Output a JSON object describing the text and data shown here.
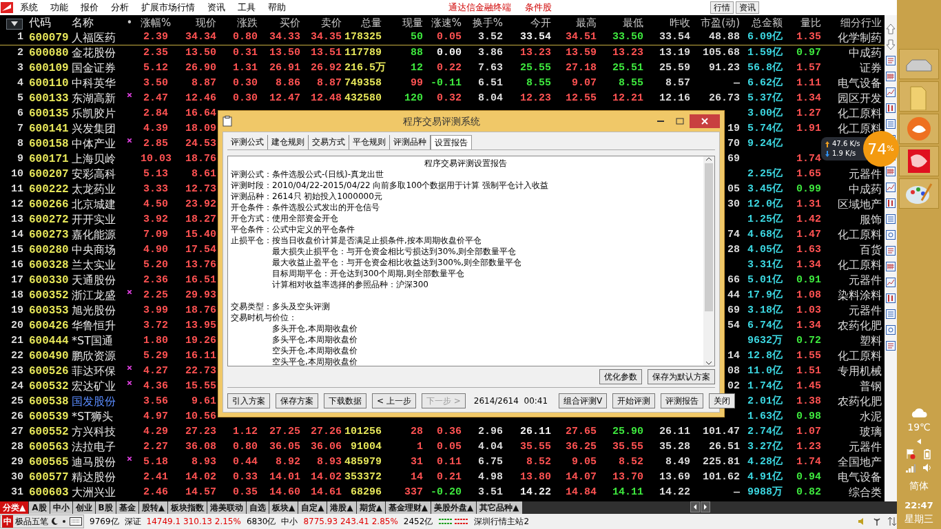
{
  "menu_bar": {
    "items": [
      "系统",
      "功能",
      "报价",
      "分析",
      "扩展市场行情",
      "资讯",
      "工具",
      "帮助"
    ],
    "titles": [
      "通达信金融终端",
      "条件股"
    ],
    "buttons": [
      "行情",
      "资讯"
    ]
  },
  "table": {
    "code_label": "代码",
    "name_label": "名称",
    "flag_label": "•",
    "columns": [
      {
        "label": "涨幅%",
        "kind": "price"
      },
      {
        "label": "现价",
        "kind": "price"
      },
      {
        "label": "涨跌",
        "kind": "price"
      },
      {
        "label": "买价",
        "kind": "price"
      },
      {
        "label": "卖价",
        "kind": "price"
      },
      {
        "label": "总量",
        "kind": "volume"
      },
      {
        "label": "现量",
        "kind": "price"
      },
      {
        "label": "涨速%",
        "kind": "price"
      },
      {
        "label": "换手%",
        "kind": "plain"
      },
      {
        "label": "今开",
        "kind": "price"
      },
      {
        "label": "最高",
        "kind": "price"
      },
      {
        "label": "最低",
        "kind": "price"
      },
      {
        "label": "昨收",
        "kind": "plain"
      },
      {
        "label": "市盈(动)",
        "kind": "plain"
      },
      {
        "label": "总金额",
        "kind": "amount"
      },
      {
        "label": "量比",
        "kind": "price"
      },
      {
        "label": "细分行业",
        "kind": "industry"
      }
    ],
    "rows": [
      {
        "no": "1",
        "code": "600079",
        "name": "人福医药",
        "flagged": false,
        "selected": true,
        "highlighted": false,
        "cells": [
          "2.39",
          "34.34",
          "0.80",
          "34.33",
          "34.35",
          "178325",
          {
            "text": "50",
            "color": "#3ee83e"
          },
          "0.05",
          "3.52",
          {
            "text": "33.54",
            "color": "#f2f2f2"
          },
          "34.51",
          {
            "text": "33.50",
            "color": "#3ee83e"
          },
          "33.54",
          "48.88",
          "6.09亿",
          "1.35",
          "化学制药"
        ]
      },
      {
        "no": "2",
        "code": "600080",
        "name": "金花股份",
        "flagged": false,
        "selected": false,
        "highlighted": false,
        "cells": [
          "2.35",
          "13.50",
          "0.31",
          "13.50",
          "13.51",
          "117789",
          {
            "text": "88",
            "color": "#3ee83e"
          },
          {
            "text": "0.00",
            "color": "#f2f2f2"
          },
          "3.86",
          "13.23",
          "13.59",
          "13.23",
          "13.19",
          "105.68",
          "1.59亿",
          {
            "text": "0.97",
            "color": "#3ee83e"
          },
          "中成药"
        ]
      },
      {
        "no": "3",
        "code": "600109",
        "name": "国金证券",
        "flagged": false,
        "selected": false,
        "highlighted": false,
        "cells": [
          "5.12",
          "26.90",
          "1.31",
          "26.91",
          "26.92",
          "216.5万",
          {
            "text": "12",
            "color": "#3ee83e"
          },
          "0.22",
          "7.63",
          {
            "text": "25.55",
            "color": "#3ee83e"
          },
          "27.18",
          {
            "text": "25.51",
            "color": "#3ee83e"
          },
          "25.59",
          "91.23",
          "56.8亿",
          "1.57",
          "证券"
        ]
      },
      {
        "no": "4",
        "code": "600110",
        "name": "中科英华",
        "flagged": false,
        "selected": false,
        "highlighted": false,
        "cells": [
          "3.50",
          "8.87",
          "0.30",
          "8.86",
          "8.87",
          "749358",
          "99",
          {
            "text": "-0.11",
            "color": "#3ee83e"
          },
          "6.51",
          {
            "text": "8.55",
            "color": "#3ee83e"
          },
          "9.07",
          {
            "text": "8.55",
            "color": "#3ee83e"
          },
          "8.57",
          "—",
          "6.62亿",
          "1.11",
          "电气设备"
        ]
      },
      {
        "no": "5",
        "code": "600133",
        "name": "东湖高新",
        "flagged": true,
        "selected": false,
        "highlighted": false,
        "cells": [
          "2.47",
          "12.46",
          "0.30",
          "12.47",
          "12.48",
          "432580",
          {
            "text": "120",
            "color": "#3ee83e"
          },
          "0.32",
          "8.04",
          "12.23",
          "12.55",
          "12.21",
          "12.16",
          "26.73",
          "5.37亿",
          "1.34",
          "园区开发"
        ]
      },
      {
        "no": "6",
        "code": "600135",
        "name": "乐凯胶片",
        "flagged": false,
        "selected": false,
        "highlighted": false,
        "cells": [
          "2.84",
          "16.64",
          null,
          null,
          null,
          null,
          null,
          null,
          null,
          null,
          null,
          null,
          null,
          null,
          "3.00亿",
          "1.27",
          "化工原料"
        ]
      },
      {
        "no": "7",
        "code": "600141",
        "name": "兴发集团",
        "flagged": false,
        "selected": false,
        "highlighted": false,
        "cells": [
          "4.39",
          "18.09",
          null,
          null,
          null,
          null,
          null,
          null,
          null,
          null,
          null,
          null,
          null,
          "19",
          "5.74亿",
          "1.91",
          "化工原料"
        ]
      },
      {
        "no": "8",
        "code": "600158",
        "name": "中体产业",
        "flagged": true,
        "selected": false,
        "highlighted": false,
        "cells": [
          "2.85",
          "24.53",
          null,
          null,
          null,
          null,
          null,
          null,
          null,
          null,
          null,
          null,
          null,
          "70",
          "9.24亿",
          null,
          null
        ]
      },
      {
        "no": "9",
        "code": "600171",
        "name": "上海贝岭",
        "flagged": false,
        "selected": false,
        "highlighted": false,
        "cells": [
          "10.03",
          "18.76",
          null,
          null,
          null,
          null,
          null,
          null,
          null,
          null,
          null,
          null,
          null,
          "69",
          null,
          "1.74",
          null
        ]
      },
      {
        "no": "10",
        "code": "600207",
        "name": "安彩高科",
        "flagged": false,
        "selected": false,
        "highlighted": false,
        "cells": [
          "5.13",
          "8.61",
          null,
          null,
          null,
          null,
          null,
          null,
          null,
          null,
          null,
          null,
          null,
          null,
          "2.25亿",
          "1.65",
          "元器件"
        ]
      },
      {
        "no": "11",
        "code": "600222",
        "name": "太龙药业",
        "flagged": false,
        "selected": false,
        "highlighted": false,
        "cells": [
          "3.33",
          "12.73",
          null,
          null,
          null,
          null,
          null,
          null,
          null,
          null,
          null,
          null,
          null,
          "05",
          "3.45亿",
          {
            "text": "0.99",
            "color": "#3ee83e"
          },
          "中成药"
        ]
      },
      {
        "no": "12",
        "code": "600266",
        "name": "北京城建",
        "flagged": false,
        "selected": false,
        "highlighted": false,
        "cells": [
          "4.50",
          "23.92",
          null,
          null,
          null,
          null,
          null,
          null,
          null,
          null,
          null,
          null,
          null,
          "30",
          "12.0亿",
          "1.31",
          "区域地产"
        ]
      },
      {
        "no": "13",
        "code": "600272",
        "name": "开开实业",
        "flagged": false,
        "selected": false,
        "highlighted": false,
        "cells": [
          "3.92",
          "18.27",
          null,
          null,
          null,
          null,
          null,
          null,
          null,
          null,
          null,
          null,
          null,
          null,
          "1.25亿",
          "1.42",
          "服饰"
        ]
      },
      {
        "no": "14",
        "code": "600273",
        "name": "嘉化能源",
        "flagged": false,
        "selected": false,
        "highlighted": false,
        "cells": [
          "7.09",
          "15.40",
          null,
          null,
          null,
          null,
          null,
          null,
          null,
          null,
          null,
          null,
          null,
          "74",
          "4.68亿",
          "1.47",
          "化工原料"
        ]
      },
      {
        "no": "15",
        "code": "600280",
        "name": "中央商场",
        "flagged": false,
        "selected": false,
        "highlighted": false,
        "cells": [
          "4.90",
          "17.54",
          null,
          null,
          null,
          null,
          null,
          null,
          null,
          null,
          null,
          null,
          null,
          "28",
          "4.05亿",
          "1.63",
          "百货"
        ]
      },
      {
        "no": "16",
        "code": "600328",
        "name": "兰太实业",
        "flagged": false,
        "selected": false,
        "highlighted": false,
        "cells": [
          "5.20",
          "13.76",
          null,
          null,
          null,
          null,
          null,
          null,
          null,
          null,
          null,
          null,
          null,
          null,
          "3.31亿",
          "1.34",
          "化工原料"
        ]
      },
      {
        "no": "17",
        "code": "600330",
        "name": "天通股份",
        "flagged": false,
        "selected": false,
        "highlighted": false,
        "cells": [
          "2.36",
          "16.51",
          null,
          null,
          null,
          null,
          null,
          null,
          null,
          null,
          null,
          null,
          null,
          "66",
          "5.01亿",
          {
            "text": "0.91",
            "color": "#3ee83e"
          },
          "元器件"
        ]
      },
      {
        "no": "18",
        "code": "600352",
        "name": "浙江龙盛",
        "flagged": true,
        "selected": false,
        "highlighted": false,
        "cells": [
          "2.25",
          "29.93",
          null,
          null,
          null,
          null,
          null,
          null,
          null,
          null,
          null,
          null,
          null,
          "44",
          "17.9亿",
          "1.08",
          "染料涂料"
        ]
      },
      {
        "no": "19",
        "code": "600353",
        "name": "旭光股份",
        "flagged": false,
        "selected": false,
        "highlighted": false,
        "cells": [
          "3.99",
          "18.76",
          null,
          null,
          null,
          null,
          null,
          null,
          null,
          null,
          null,
          null,
          null,
          "69",
          "3.18亿",
          "1.03",
          "元器件"
        ]
      },
      {
        "no": "20",
        "code": "600426",
        "name": "华鲁恒升",
        "flagged": false,
        "selected": false,
        "highlighted": false,
        "cells": [
          "3.72",
          "13.95",
          null,
          null,
          null,
          null,
          null,
          null,
          null,
          null,
          null,
          null,
          null,
          "54",
          "6.74亿",
          "1.34",
          "农药化肥"
        ]
      },
      {
        "no": "21",
        "code": "600444",
        "name": "*ST国通",
        "flagged": false,
        "selected": false,
        "highlighted": false,
        "cells": [
          "1.80",
          "19.26",
          null,
          null,
          null,
          null,
          null,
          null,
          null,
          null,
          null,
          null,
          null,
          null,
          "9632万",
          {
            "text": "0.72",
            "color": "#3ee83e"
          },
          "塑料"
        ]
      },
      {
        "no": "22",
        "code": "600490",
        "name": "鹏欣资源",
        "flagged": false,
        "selected": false,
        "highlighted": false,
        "cells": [
          "5.29",
          "16.11",
          null,
          null,
          null,
          null,
          null,
          null,
          null,
          null,
          null,
          null,
          null,
          "14",
          "12.8亿",
          "1.55",
          "化工原料"
        ]
      },
      {
        "no": "23",
        "code": "600526",
        "name": "菲达环保",
        "flagged": true,
        "selected": false,
        "highlighted": false,
        "cells": [
          "4.27",
          "22.73",
          null,
          null,
          null,
          null,
          null,
          null,
          null,
          null,
          null,
          null,
          null,
          "08",
          "11.0亿",
          "1.51",
          "专用机械"
        ]
      },
      {
        "no": "24",
        "code": "600532",
        "name": "宏达矿业",
        "flagged": true,
        "selected": false,
        "highlighted": false,
        "cells": [
          "4.36",
          "15.55",
          null,
          null,
          null,
          null,
          null,
          null,
          null,
          null,
          null,
          null,
          null,
          "02",
          "1.74亿",
          "1.45",
          "普钢"
        ]
      },
      {
        "no": "25",
        "code": "600538",
        "name": "国发股份",
        "flagged": false,
        "selected": false,
        "highlighted": true,
        "cells": [
          "3.56",
          "9.61",
          null,
          null,
          null,
          null,
          null,
          null,
          null,
          null,
          null,
          null,
          null,
          null,
          "2.01亿",
          "1.38",
          "农药化肥"
        ]
      },
      {
        "no": "26",
        "code": "600539",
        "name": "*ST狮头",
        "flagged": false,
        "selected": false,
        "highlighted": false,
        "cells": [
          "4.97",
          "10.56",
          null,
          null,
          null,
          null,
          null,
          null,
          null,
          null,
          null,
          null,
          null,
          null,
          "1.63亿",
          {
            "text": "0.98",
            "color": "#3ee83e"
          },
          "水泥"
        ]
      },
      {
        "no": "27",
        "code": "600552",
        "name": "方兴科技",
        "flagged": false,
        "selected": false,
        "highlighted": false,
        "cells": [
          "4.29",
          "27.23",
          "1.12",
          "27.25",
          "27.26",
          "101256",
          "28",
          "0.36",
          "2.96",
          {
            "text": "26.11",
            "color": "#f2f2f2"
          },
          "27.65",
          {
            "text": "25.90",
            "color": "#3ee83e"
          },
          "26.11",
          "101.47",
          "2.74亿",
          "1.07",
          "玻璃"
        ]
      },
      {
        "no": "28",
        "code": "600563",
        "name": "法拉电子",
        "flagged": false,
        "selected": false,
        "highlighted": false,
        "cells": [
          "2.27",
          "36.08",
          "0.80",
          "36.05",
          "36.06",
          "91004",
          "1",
          "0.05",
          "4.04",
          "35.55",
          "36.25",
          "35.55",
          "35.28",
          "26.51",
          "3.27亿",
          "1.23",
          "元器件"
        ]
      },
      {
        "no": "29",
        "code": "600565",
        "name": "迪马股份",
        "flagged": true,
        "selected": false,
        "highlighted": false,
        "cells": [
          "5.18",
          "8.93",
          "0.44",
          "8.92",
          "8.93",
          "485979",
          "31",
          "0.11",
          "6.75",
          "8.52",
          "9.05",
          "8.52",
          "8.49",
          "225.81",
          "4.28亿",
          "1.74",
          "全国地产"
        ]
      },
      {
        "no": "30",
        "code": "600577",
        "name": "精达股份",
        "flagged": false,
        "selected": false,
        "highlighted": false,
        "cells": [
          "2.41",
          "14.02",
          "0.33",
          "14.01",
          "14.02",
          "353372",
          "14",
          "0.21",
          "4.98",
          "13.80",
          "14.07",
          "13.70",
          "13.69",
          "101.62",
          "4.91亿",
          {
            "text": "0.94",
            "color": "#3ee83e"
          },
          "电气设备"
        ]
      },
      {
        "no": "31",
        "code": "600603",
        "name": "大洲兴业",
        "flagged": false,
        "selected": false,
        "highlighted": false,
        "cells": [
          "2.46",
          "14.57",
          "0.35",
          "14.60",
          "14.61",
          "68296",
          "337",
          {
            "text": "-0.20",
            "color": "#3ee83e"
          },
          "3.51",
          {
            "text": "14.22",
            "color": "#f2f2f2"
          },
          "14.84",
          {
            "text": "14.11",
            "color": "#3ee83e"
          },
          "14.22",
          "—",
          "9988万",
          {
            "text": "0.82",
            "color": "#3ee83e"
          },
          "综合类"
        ]
      }
    ]
  },
  "market_tabs": [
    {
      "label": "分类▲",
      "selected": true
    },
    {
      "label": "A股",
      "selected": false
    },
    {
      "label": "中小",
      "selected": false
    },
    {
      "label": "创业",
      "selected": false
    },
    {
      "label": "B股",
      "selected": false
    },
    {
      "label": "基金",
      "selected": false
    },
    {
      "label": "股转▲",
      "selected": false
    },
    {
      "label": "板块指数",
      "selected": false
    },
    {
      "label": "港美联动",
      "selected": false
    },
    {
      "label": "自选",
      "selected": false
    },
    {
      "label": "板块▲",
      "selected": false
    },
    {
      "label": "自定▲",
      "selected": false
    },
    {
      "label": "港股▲",
      "selected": false
    },
    {
      "label": "期货▲",
      "selected": false
    },
    {
      "label": "基金理财▲",
      "selected": false
    },
    {
      "label": "美股外盘▲",
      "selected": false
    },
    {
      "label": "其它品种▲",
      "selected": false
    }
  ],
  "status_bar": {
    "ime": {
      "mode": "中",
      "name": "极品五笔"
    },
    "tickers": [
      {
        "amount": "9769亿"
      },
      {
        "label": "深证",
        "quote": "14749.1  310.13  2.15%",
        "rising": true,
        "amount": "6830亿"
      },
      {
        "label": "中小",
        "quote": "8775.93  243.41  2.85%",
        "rising": true,
        "amount": "2452亿"
      }
    ],
    "server": "深圳行情主站2"
  },
  "dialog": {
    "title": "程序交易评测系统",
    "tabs": [
      {
        "label": "评测公式",
        "selected": false
      },
      {
        "label": "建仓规则",
        "selected": false
      },
      {
        "label": "交易方式",
        "selected": false
      },
      {
        "label": "平仓规则",
        "selected": false
      },
      {
        "label": "评测品种",
        "selected": false
      },
      {
        "label": "设置报告",
        "selected": true
      }
    ],
    "report": [
      {
        "kind": "title",
        "text": "程序交易评测设置报告"
      },
      {
        "kind": "line",
        "text": "评测公式：条件选股公式-(日线)-真龙出世"
      },
      {
        "kind": "line",
        "text": "评测时段：2010/04/22-2015/04/22 向前多取100个数据用于计算 强制平仓计入收益"
      },
      {
        "kind": "line",
        "text": "评测品种：2614只  初始投入1000000元"
      },
      {
        "kind": "line",
        "text": "开仓条件：条件选股公式发出的开仓信号"
      },
      {
        "kind": "line",
        "text": "开仓方式：使用全部资金开仓"
      },
      {
        "kind": "line",
        "text": "平仓条件：公式中定义的平仓条件"
      },
      {
        "kind": "line",
        "text": "止损平仓：按当日收盘价计算是否满足止损条件,按本周期收盘价平仓"
      },
      {
        "kind": "indent",
        "text": "最大损失止损平仓：与开仓资金相比亏损达到30%,则全部数量平仓"
      },
      {
        "kind": "indent",
        "text": "最大收益止盈平仓：与开仓资金相比收益达到300%,则全部数量平仓"
      },
      {
        "kind": "indent",
        "text": "目标周期平仓：开仓达到300个周期,则全部数量平仓"
      },
      {
        "kind": "indent",
        "text": "计算相对收益率选择的参照品种：沪深300"
      },
      {
        "kind": "gap"
      },
      {
        "kind": "line",
        "text": "交易类型：多头及空头评测"
      },
      {
        "kind": "line",
        "text": "交易时机与价位："
      },
      {
        "kind": "indent",
        "text": "多头开仓,本周期收盘价"
      },
      {
        "kind": "indent",
        "text": "多头平仓,本周期收盘价"
      },
      {
        "kind": "indent",
        "text": "空头开仓,本周期收盘价"
      },
      {
        "kind": "indent",
        "text": "空头平仓,本周期收盘价"
      }
    ],
    "report_buttons": [
      "优化参数",
      "保存为默认方案"
    ],
    "buttons": [
      {
        "label": "引入方案",
        "disabled": false
      },
      {
        "label": "保存方案",
        "disabled": false
      },
      {
        "label": "下载数据",
        "disabled": false
      },
      {
        "label": "< 上一步",
        "disabled": false
      },
      {
        "label": "下一步 >",
        "disabled": true
      }
    ],
    "progress": "2614/2614  00:41",
    "action_buttons": [
      {
        "label": "组合评测V",
        "disabled": false
      },
      {
        "label": "开始评测",
        "disabled": false
      },
      {
        "label": "评测报告",
        "disabled": false
      },
      {
        "label": "关闭",
        "disabled": false
      }
    ]
  },
  "net_widget": {
    "upload": "47.6",
    "upload_unit": "K/s",
    "download": "1.9",
    "download_unit": "K/s",
    "percent": "74",
    "percent_sign": "%"
  },
  "taskbar": {
    "temperature": "19℃",
    "ime_mode": "简体",
    "time": "22:47",
    "weekday": "星期三"
  }
}
